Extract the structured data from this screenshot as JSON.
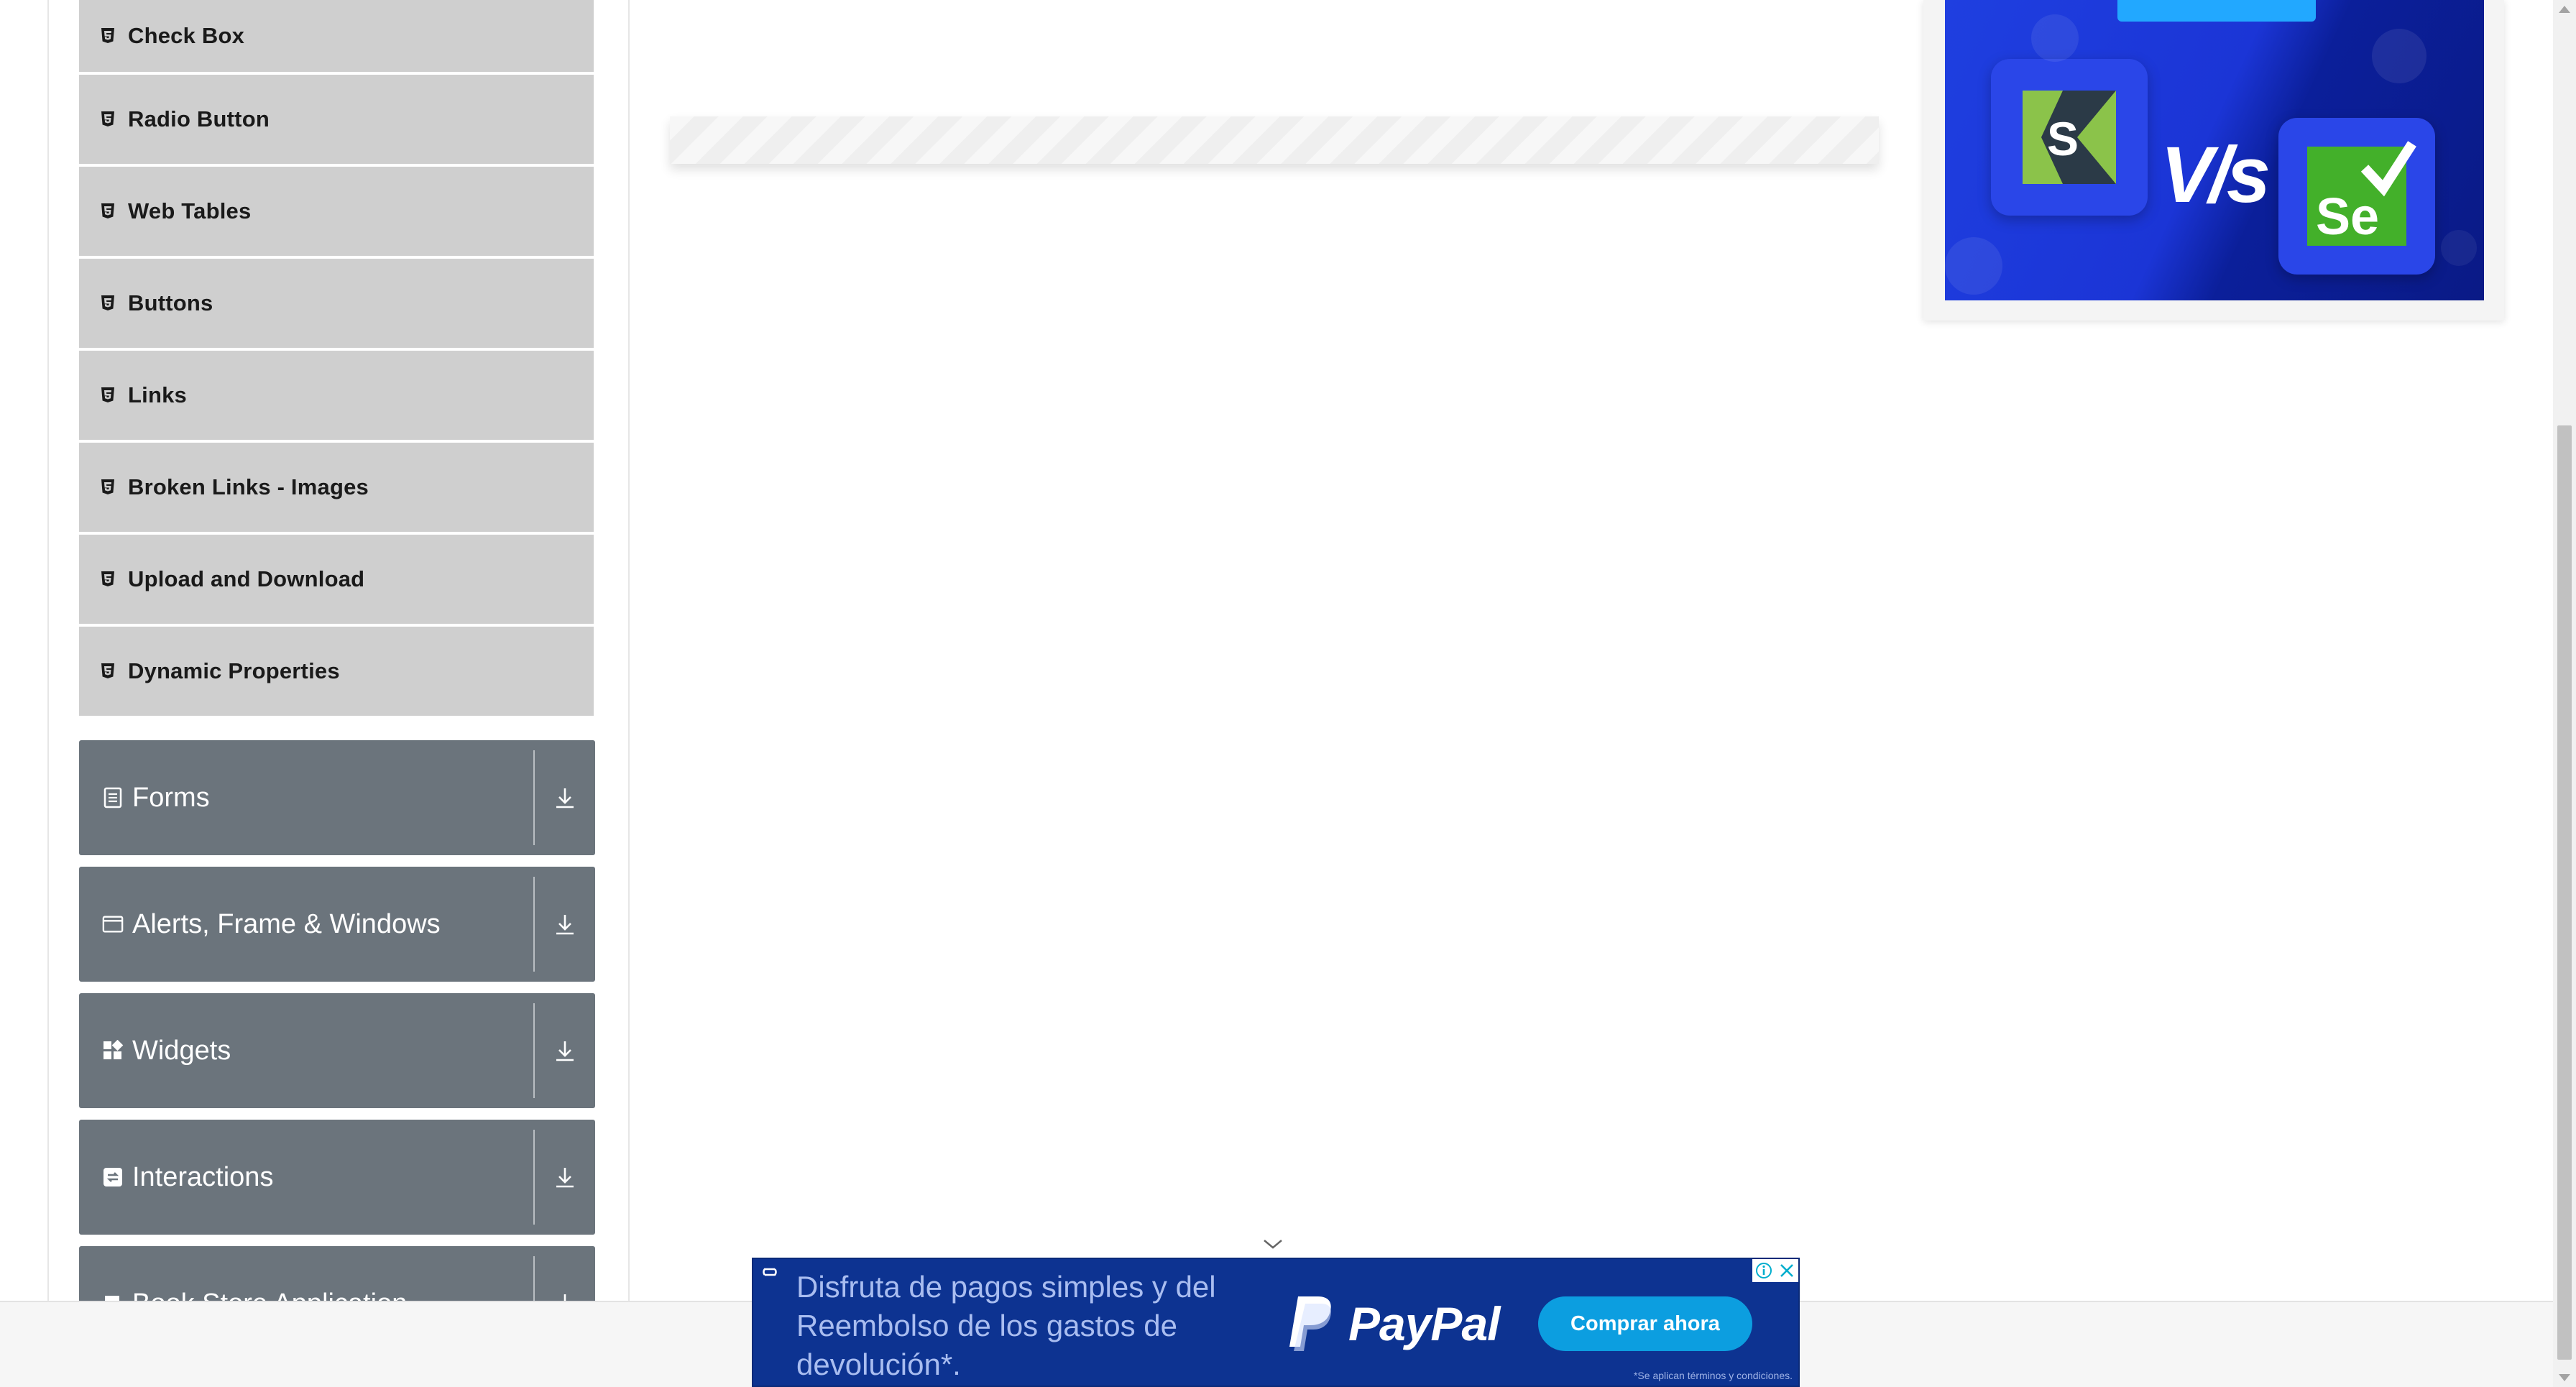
{
  "sidebar": {
    "elements_items": [
      {
        "label": "Check Box"
      },
      {
        "label": "Radio Button"
      },
      {
        "label": "Web Tables"
      },
      {
        "label": "Buttons"
      },
      {
        "label": "Links"
      },
      {
        "label": "Broken Links - Images"
      },
      {
        "label": "Upload and Download"
      },
      {
        "label": "Dynamic Properties"
      }
    ],
    "groups": [
      {
        "label": "Forms",
        "icon": "form-icon"
      },
      {
        "label": "Alerts, Frame & Windows",
        "icon": "window-icon"
      },
      {
        "label": "Widgets",
        "icon": "widgets-icon"
      },
      {
        "label": "Interactions",
        "icon": "interactions-icon"
      },
      {
        "label": "Book Store Application",
        "icon": "book-icon"
      }
    ]
  },
  "right_ad": {
    "vs_text": "V/s",
    "left_logo": "S",
    "right_logo": "Se"
  },
  "paypal_ad": {
    "headline": "Disfruta de pagos simples y del\nReembolso de los gastos de\ndevolución*.",
    "brand": "PayPal",
    "cta": "Comprar ahora",
    "terms": "*Se aplican términos y condiciones."
  },
  "colors": {
    "menu_item_bg": "#cfcfcf",
    "group_bg": "#6b747c",
    "ad_blue": "#0d3391",
    "cta_blue": "#0c9ee0"
  }
}
